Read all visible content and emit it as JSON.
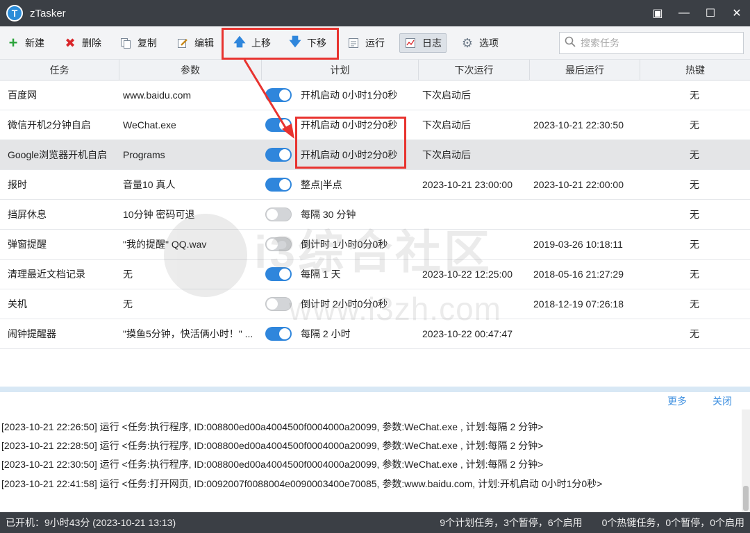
{
  "window": {
    "logo_letter": "T",
    "title": "zTasker",
    "controls": [
      "▣",
      "—",
      "☐",
      "✕"
    ]
  },
  "toolbar": {
    "new": "新建",
    "delete": "删除",
    "copy": "复制",
    "edit": "编辑",
    "move_up": "上移",
    "move_down": "下移",
    "run": "运行",
    "log": "日志",
    "options": "选项",
    "search_placeholder": "搜索任务"
  },
  "table": {
    "columns": [
      "任务",
      "参数",
      "计划",
      "下次运行",
      "最后运行",
      "热键"
    ],
    "rows": [
      {
        "task": "百度网",
        "param": "www.baidu.com",
        "enabled": true,
        "plan": "开机启动 0小时1分0秒",
        "next": "下次启动后",
        "last": "",
        "hotkey": "无"
      },
      {
        "task": "微信开机2分钟自启",
        "param": "WeChat.exe",
        "enabled": true,
        "plan": "开机启动 0小时2分0秒",
        "next": "下次启动后",
        "last": "2023-10-21 22:30:50",
        "hotkey": "无"
      },
      {
        "task": "Google浏览器开机自启",
        "param": "Programs",
        "enabled": true,
        "plan": "开机启动 0小时2分0秒",
        "next": "下次启动后",
        "last": "",
        "hotkey": "无"
      },
      {
        "task": "报时",
        "param": "音量10 真人",
        "enabled": true,
        "plan": "整点|半点",
        "next": "2023-10-21 23:00:00",
        "last": "2023-10-21 22:00:00",
        "hotkey": "无"
      },
      {
        "task": "挡屏休息",
        "param": "10分钟 密码可退",
        "enabled": false,
        "plan": "每隔 30 分钟",
        "next": "",
        "last": "",
        "hotkey": "无"
      },
      {
        "task": "弹窗提醒",
        "param": "\"我的提醒\" QQ.wav",
        "enabled": false,
        "plan": "倒计时 1小时0分0秒",
        "next": "",
        "last": "2019-03-26 10:18:11",
        "hotkey": "无"
      },
      {
        "task": "清理最近文档记录",
        "param": "无",
        "enabled": true,
        "plan": "每隔 1 天",
        "next": "2023-10-22 12:25:00",
        "last": "2018-05-16 21:27:29",
        "hotkey": "无"
      },
      {
        "task": "关机",
        "param": "无",
        "enabled": false,
        "plan": "倒计时 2小时0分0秒",
        "next": "",
        "last": "2018-12-19 07:26:18",
        "hotkey": "无"
      },
      {
        "task": "闹钟提醒器",
        "param": "\"摸鱼5分钟，快活俩小时！\" ...",
        "enabled": true,
        "plan": "每隔 2 小时",
        "next": "2023-10-22 00:47:47",
        "last": "",
        "hotkey": "无"
      }
    ]
  },
  "watermark": {
    "name": "i3综合社区",
    "url": "www.i3zh.com"
  },
  "log_panel": {
    "more": "更多",
    "close": "关闭",
    "lines": [
      "[2023-10-21 22:26:50] 运行 <任务:执行程序, ID:008800ed00a4004500f0004000a20099, 参数:WeChat.exe , 计划:每隔 2 分钟>",
      "[2023-10-21 22:28:50] 运行 <任务:执行程序, ID:008800ed00a4004500f0004000a20099, 参数:WeChat.exe , 计划:每隔 2 分钟>",
      "[2023-10-21 22:30:50] 运行 <任务:执行程序, ID:008800ed00a4004500f0004000a20099, 参数:WeChat.exe , 计划:每隔 2 分钟>",
      "[2023-10-21 22:41:58] 运行 <任务:打开网页, ID:0092007f0088004e0090003400e70085, 参数:www.baidu.com, 计划:开机启动 0小时1分0秒>"
    ]
  },
  "status": {
    "left": "已开机：9小时43分 (2023-10-21 13:13)",
    "right": "9个计划任务，3个暂停，6个启用　　0个热键任务，0个暂停，0个启用"
  },
  "colors": {
    "toggle_on": "#2f86dc",
    "annotation": "#e8332f",
    "titlebar": "#3b3f45"
  }
}
